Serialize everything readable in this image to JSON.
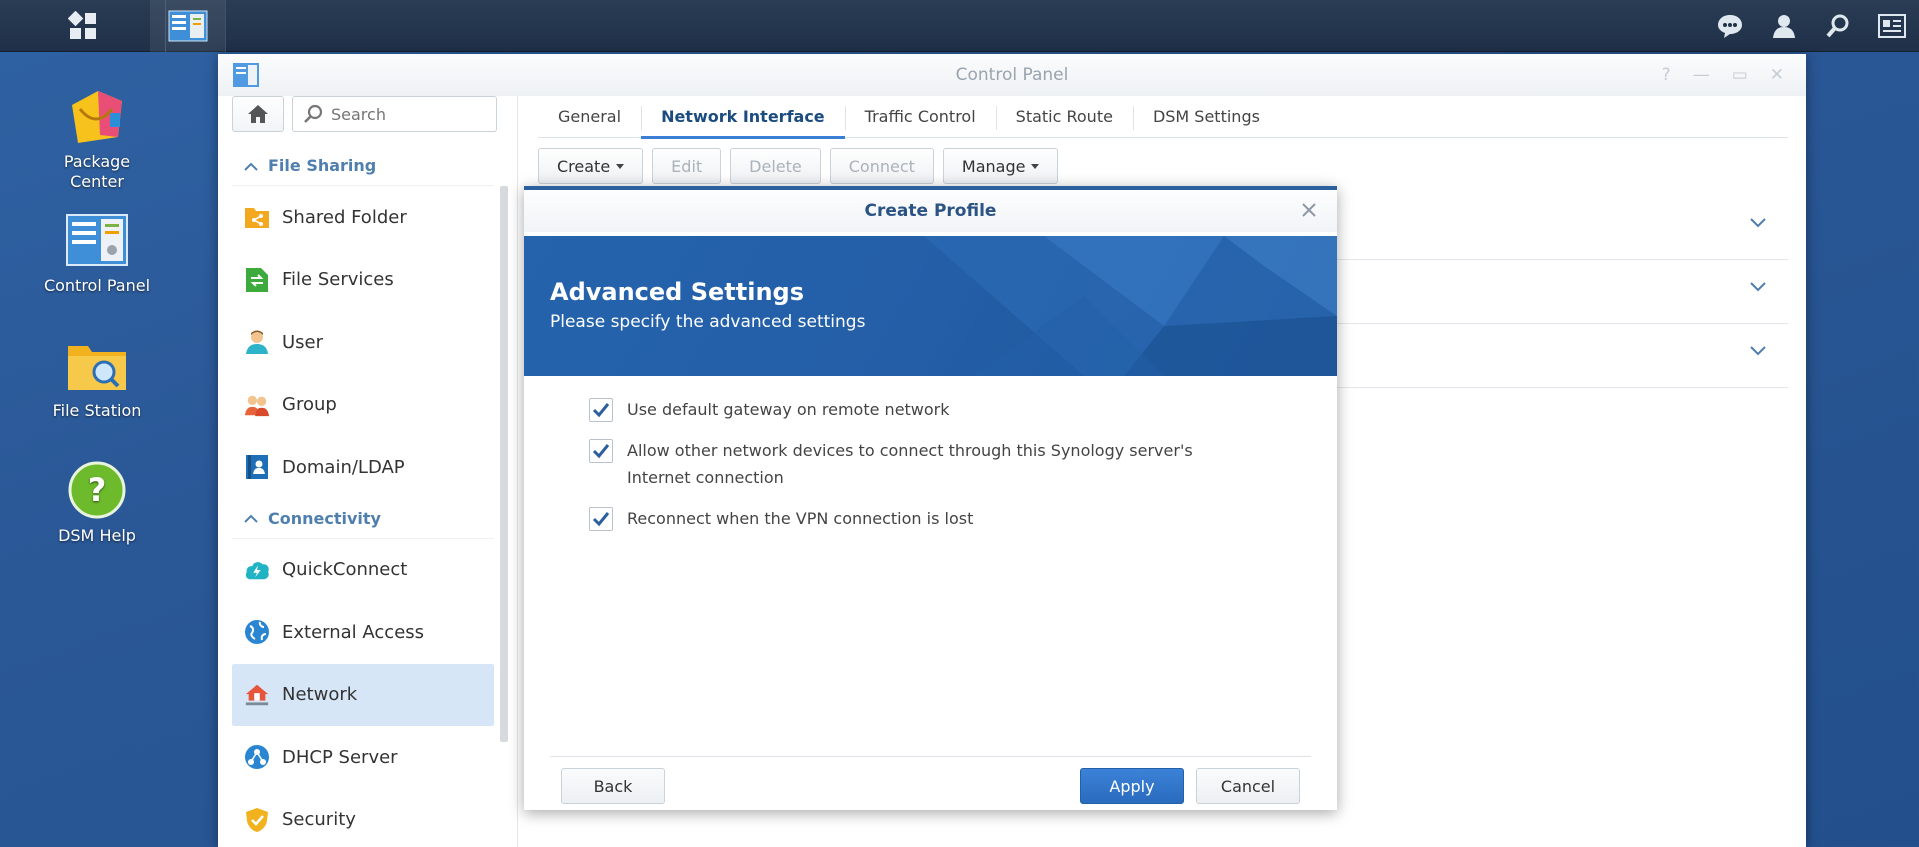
{
  "desktop": {
    "icons": [
      {
        "label_line1": "Package",
        "label_line2": "Center",
        "icon": "package-center-icon"
      },
      {
        "label_line1": "Control Panel",
        "label_line2": "",
        "icon": "control-panel-icon"
      },
      {
        "label_line1": "File Station",
        "label_line2": "",
        "icon": "file-station-icon"
      },
      {
        "label_line1": "DSM Help",
        "label_line2": "",
        "icon": "dsm-help-icon"
      }
    ]
  },
  "taskbar": {
    "right_icons": [
      "chat-icon",
      "user-icon",
      "search-icon",
      "widgets-icon"
    ]
  },
  "window": {
    "title": "Control Panel",
    "controls": [
      "?",
      "—",
      "▭",
      "✕"
    ]
  },
  "sidebar": {
    "search_placeholder": "Search",
    "sections": [
      {
        "title": "File Sharing",
        "items": [
          "Shared Folder",
          "File Services",
          "User",
          "Group",
          "Domain/LDAP"
        ]
      },
      {
        "title": "Connectivity",
        "items": [
          "QuickConnect",
          "External Access",
          "Network",
          "DHCP Server",
          "Security"
        ]
      }
    ],
    "active_item": "Network"
  },
  "tabs": [
    "General",
    "Network Interface",
    "Traffic Control",
    "Static Route",
    "DSM Settings"
  ],
  "active_tab": "Network Interface",
  "toolbar": {
    "create": "Create",
    "edit": "Edit",
    "delete": "Delete",
    "connect": "Connect",
    "manage": "Manage"
  },
  "modal": {
    "title": "Create Profile",
    "banner_title": "Advanced Settings",
    "banner_subtitle": "Please specify the advanced settings",
    "options": [
      {
        "label": "Use default gateway on remote network",
        "checked": true
      },
      {
        "label": "Allow other network devices to connect through this Synology server's Internet connection",
        "checked": true
      },
      {
        "label": "Reconnect when the VPN connection is lost",
        "checked": true
      }
    ],
    "back": "Back",
    "apply": "Apply",
    "cancel": "Cancel"
  },
  "colors": {
    "accent": "#3a7ed6",
    "primary_button": "#2a6bbd",
    "active_sidebar": "#d7e6f7",
    "desktop_bg": "#2a5796"
  }
}
